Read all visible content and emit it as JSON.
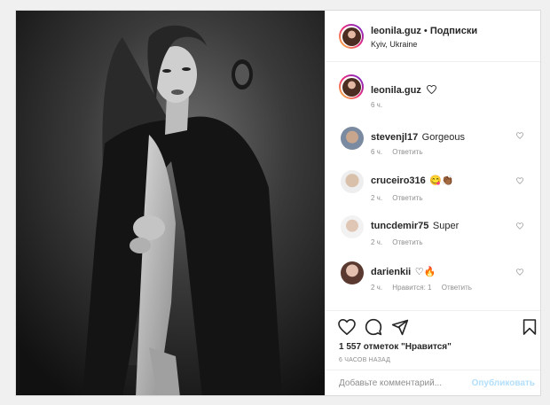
{
  "post": {
    "username": "leonila.guz",
    "separator": "•",
    "follow_label": "Подписки",
    "location": "Kyiv, Ukraine",
    "caption_author": "leonila.guz",
    "caption_time": "6 ч."
  },
  "comments": [
    {
      "user": "stevenjl17",
      "text": "Gorgeous",
      "time": "6 ч.",
      "likes": "",
      "reply": "Ответить"
    },
    {
      "user": "cruceiro316",
      "text": "😋👏🏾",
      "time": "2 ч.",
      "likes": "",
      "reply": "Ответить"
    },
    {
      "user": "tuncdemir75",
      "text": "Super",
      "time": "2 ч.",
      "likes": "",
      "reply": "Ответить"
    },
    {
      "user": "darienkii",
      "text": "♡🔥",
      "time": "2 ч.",
      "likes": "Нравится: 1",
      "reply": "Ответить"
    }
  ],
  "actions": {
    "likes_text": "1 557 отметок \"Нравится\"",
    "timestamp": "6 ЧАСОВ НАЗАД",
    "add_comment_placeholder": "Добавьте комментарий...",
    "publish_label": "Опубликовать"
  },
  "icons": {
    "like": "heart-icon",
    "comment": "comment-icon",
    "share": "share-icon",
    "save": "bookmark-icon"
  },
  "colors": {
    "publish": "#b2dffc",
    "muted": "#8e8e8e",
    "text": "#262626"
  }
}
